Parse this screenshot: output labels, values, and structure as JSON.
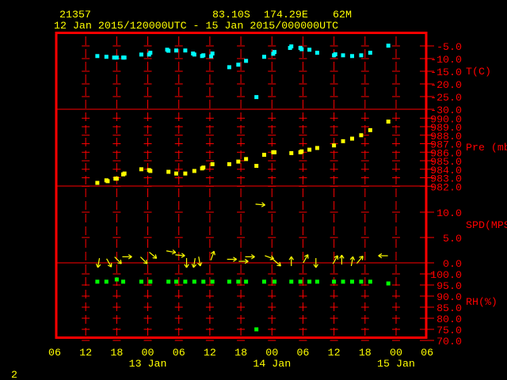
{
  "header": {
    "station_id": "21357",
    "latitude": "83.10S",
    "longitude": "174.29E",
    "elevation": "62M",
    "period": "12 Jan 2015/120000UTC - 15 Jan 2015/000000UTC"
  },
  "footer": {
    "page_number": "2"
  },
  "colors": {
    "frame": "#ff0000",
    "text": "#ffff00",
    "temperature": "#00ffff",
    "pressure": "#ffff00",
    "wind": "#ffff00",
    "humidity": "#00ff00"
  },
  "chart_data": {
    "type": "scatter",
    "grid": true,
    "x_axis": {
      "range": [
        "2015-01-12T06:00",
        "2015-01-15T06:00"
      ],
      "ticks": [
        {
          "time": "2015-01-12T06:00",
          "label": "06"
        },
        {
          "time": "2015-01-12T12:00",
          "label": "12"
        },
        {
          "time": "2015-01-12T18:00",
          "label": "18"
        },
        {
          "time": "2015-01-13T00:00",
          "label": "00"
        },
        {
          "time": "2015-01-13T06:00",
          "label": "06"
        },
        {
          "time": "2015-01-13T12:00",
          "label": "12"
        },
        {
          "time": "2015-01-13T18:00",
          "label": "18"
        },
        {
          "time": "2015-01-14T00:00",
          "label": "00"
        },
        {
          "time": "2015-01-14T06:00",
          "label": "06"
        },
        {
          "time": "2015-01-14T12:00",
          "label": "12"
        },
        {
          "time": "2015-01-14T18:00",
          "label": "18"
        },
        {
          "time": "2015-01-15T00:00",
          "label": "00"
        },
        {
          "time": "2015-01-15T06:00",
          "label": "06"
        }
      ],
      "date_labels": [
        {
          "time": "2015-01-13T00:00",
          "label": "13 Jan"
        },
        {
          "time": "2015-01-14T00:00",
          "label": "14 Jan"
        },
        {
          "time": "2015-01-15T00:00",
          "label": "15 Jan"
        }
      ]
    },
    "panels": [
      {
        "key": "temperature",
        "ylabel": "T(C)",
        "ylim": [
          -30,
          0
        ],
        "color": "#00ffff",
        "ticks": [
          -5,
          -10,
          -15,
          -20,
          -25,
          -30
        ],
        "tick_labels": [
          "-5.0",
          "-10.0",
          "-15.0",
          "-20.0",
          "-25.0",
          "-30.0"
        ],
        "points": [
          [
            "2015-01-12T14:15",
            -9.0
          ],
          [
            "2015-01-12T16:00",
            -9.3
          ],
          [
            "2015-01-12T17:30",
            -9.6
          ],
          [
            "2015-01-12T18:00",
            -9.6
          ],
          [
            "2015-01-12T19:15",
            -9.6
          ],
          [
            "2015-01-12T19:30",
            -9.6
          ],
          [
            "2015-01-12T22:45",
            -8.4
          ],
          [
            "2015-01-13T00:15",
            -8.4
          ],
          [
            "2015-01-13T00:30",
            -7.7
          ],
          [
            "2015-01-13T03:45",
            -6.5
          ],
          [
            "2015-01-13T04:00",
            -6.9
          ],
          [
            "2015-01-13T05:30",
            -6.8
          ],
          [
            "2015-01-13T07:15",
            -6.8
          ],
          [
            "2015-01-13T08:45",
            -8.0
          ],
          [
            "2015-01-13T09:00",
            -8.4
          ],
          [
            "2015-01-13T10:30",
            -9.0
          ],
          [
            "2015-01-13T10:45",
            -8.7
          ],
          [
            "2015-01-13T12:15",
            -9.1
          ],
          [
            "2015-01-13T12:30",
            -8.0
          ],
          [
            "2015-01-13T15:45",
            -13.4
          ],
          [
            "2015-01-13T17:30",
            -12.4
          ],
          [
            "2015-01-13T19:00",
            -10.9
          ],
          [
            "2015-01-13T21:00",
            -25.2
          ],
          [
            "2015-01-13T22:30",
            -9.3
          ],
          [
            "2015-01-14T00:15",
            -8.1
          ],
          [
            "2015-01-14T00:30",
            -7.4
          ],
          [
            "2015-01-14T03:30",
            -5.8
          ],
          [
            "2015-01-14T03:45",
            -5.2
          ],
          [
            "2015-01-14T05:30",
            -5.8
          ],
          [
            "2015-01-14T05:45",
            -6.3
          ],
          [
            "2015-01-14T07:15",
            -6.5
          ],
          [
            "2015-01-14T08:45",
            -7.7
          ],
          [
            "2015-01-14T12:00",
            -8.7
          ],
          [
            "2015-01-14T12:15",
            -8.3
          ],
          [
            "2015-01-14T13:45",
            -8.7
          ],
          [
            "2015-01-14T15:30",
            -9.0
          ],
          [
            "2015-01-14T17:15",
            -8.7
          ],
          [
            "2015-01-14T19:00",
            -7.7
          ],
          [
            "2015-01-14T22:30",
            -4.9
          ]
        ]
      },
      {
        "key": "pressure",
        "ylabel": "Pre (mb)",
        "ylim": [
          982,
          991
        ],
        "color": "#ffff00",
        "ticks": [
          990,
          989,
          988,
          987,
          986,
          985,
          984,
          983,
          982
        ],
        "tick_labels": [
          "990.0",
          "989.0",
          "988.0",
          "987.0",
          "986.0",
          "985.0",
          "984.0",
          "983.0",
          "982.0"
        ],
        "points": [
          [
            "2015-01-12T14:15",
            982.4
          ],
          [
            "2015-01-12T16:00",
            982.7
          ],
          [
            "2015-01-12T16:15",
            982.6
          ],
          [
            "2015-01-12T17:45",
            982.9
          ],
          [
            "2015-01-12T18:00",
            982.9
          ],
          [
            "2015-01-12T19:15",
            983.4
          ],
          [
            "2015-01-12T19:30",
            983.5
          ],
          [
            "2015-01-12T22:45",
            984.0
          ],
          [
            "2015-01-13T00:15",
            983.9
          ],
          [
            "2015-01-13T00:30",
            983.8
          ],
          [
            "2015-01-13T04:00",
            983.7
          ],
          [
            "2015-01-13T05:30",
            983.5
          ],
          [
            "2015-01-13T07:15",
            983.5
          ],
          [
            "2015-01-13T09:00",
            983.8
          ],
          [
            "2015-01-13T10:30",
            984.1
          ],
          [
            "2015-01-13T10:45",
            984.2
          ],
          [
            "2015-01-13T12:30",
            984.6
          ],
          [
            "2015-01-13T15:45",
            984.6
          ],
          [
            "2015-01-13T17:30",
            984.9
          ],
          [
            "2015-01-13T19:00",
            985.2
          ],
          [
            "2015-01-13T21:00",
            984.4
          ],
          [
            "2015-01-13T22:30",
            985.7
          ],
          [
            "2015-01-14T00:15",
            986.0
          ],
          [
            "2015-01-14T00:30",
            986.0
          ],
          [
            "2015-01-14T03:45",
            985.9
          ],
          [
            "2015-01-14T05:30",
            986.0
          ],
          [
            "2015-01-14T05:45",
            986.1
          ],
          [
            "2015-01-14T07:15",
            986.3
          ],
          [
            "2015-01-14T08:45",
            986.5
          ],
          [
            "2015-01-14T12:00",
            986.8
          ],
          [
            "2015-01-14T13:45",
            987.3
          ],
          [
            "2015-01-14T15:30",
            987.6
          ],
          [
            "2015-01-14T17:15",
            988.0
          ],
          [
            "2015-01-14T19:00",
            988.6
          ],
          [
            "2015-01-14T22:30",
            989.6
          ]
        ]
      },
      {
        "key": "wind",
        "ylabel": "SPD(MPS)",
        "ylim": [
          0,
          15
        ],
        "color": "#ffff00",
        "ticks": [
          10,
          5,
          0
        ],
        "tick_labels": [
          "10.0",
          "5.0",
          "0.0"
        ],
        "points_fields": [
          "time",
          "speed_mps",
          "arrow_heading_deg"
        ],
        "points": [
          [
            "2015-01-12T14:30",
            0.0,
            190
          ],
          [
            "2015-01-12T16:30",
            0.0,
            150
          ],
          [
            "2015-01-12T18:15",
            0.5,
            135
          ],
          [
            "2015-01-12T20:00",
            1.2,
            90
          ],
          [
            "2015-01-12T23:15",
            0.5,
            135
          ],
          [
            "2015-01-13T01:00",
            1.5,
            130
          ],
          [
            "2015-01-13T04:30",
            2.2,
            100
          ],
          [
            "2015-01-13T06:15",
            1.5,
            95
          ],
          [
            "2015-01-13T07:30",
            0.0,
            180
          ],
          [
            "2015-01-13T09:00",
            0.0,
            190
          ],
          [
            "2015-01-13T10:00",
            0.3,
            170
          ],
          [
            "2015-01-13T12:30",
            1.4,
            20
          ],
          [
            "2015-01-13T16:15",
            0.7,
            90
          ],
          [
            "2015-01-13T18:30",
            0.3,
            90
          ],
          [
            "2015-01-13T19:45",
            1.2,
            90
          ],
          [
            "2015-01-13T21:45",
            11.5,
            95
          ],
          [
            "2015-01-13T23:30",
            1.1,
            110
          ],
          [
            "2015-01-14T01:00",
            0.0,
            130
          ],
          [
            "2015-01-14T03:45",
            0.3,
            0
          ],
          [
            "2015-01-14T06:30",
            0.8,
            30
          ],
          [
            "2015-01-14T08:30",
            0.0,
            180
          ],
          [
            "2015-01-14T12:15",
            0.6,
            30
          ],
          [
            "2015-01-14T13:30",
            0.6,
            0
          ],
          [
            "2015-01-14T15:30",
            0.3,
            10
          ],
          [
            "2015-01-14T17:00",
            0.6,
            40
          ],
          [
            "2015-01-14T21:30",
            1.4,
            270
          ]
        ]
      },
      {
        "key": "humidity",
        "ylabel": "RH(%)",
        "ylim": [
          70,
          105
        ],
        "color": "#00ff00",
        "ticks": [
          100,
          95,
          90,
          85,
          80,
          75,
          70
        ],
        "tick_labels": [
          "100.0",
          "95.0",
          "90.0",
          "85.0",
          "80.0",
          "75.0",
          "70.0"
        ],
        "points": [
          [
            "2015-01-12T14:15",
            96.5
          ],
          [
            "2015-01-12T16:00",
            96.5
          ],
          [
            "2015-01-12T18:00",
            97.5
          ],
          [
            "2015-01-12T19:15",
            96.5
          ],
          [
            "2015-01-12T22:45",
            96.5
          ],
          [
            "2015-01-13T00:30",
            96.5
          ],
          [
            "2015-01-13T04:00",
            96.5
          ],
          [
            "2015-01-13T05:30",
            96.5
          ],
          [
            "2015-01-13T07:15",
            96.5
          ],
          [
            "2015-01-13T09:00",
            96.5
          ],
          [
            "2015-01-13T10:45",
            96.5
          ],
          [
            "2015-01-13T12:30",
            96.5
          ],
          [
            "2015-01-13T15:45",
            96.5
          ],
          [
            "2015-01-13T17:30",
            96.5
          ],
          [
            "2015-01-13T19:00",
            96.5
          ],
          [
            "2015-01-13T21:00",
            75.0
          ],
          [
            "2015-01-13T22:30",
            96.5
          ],
          [
            "2015-01-14T00:30",
            96.5
          ],
          [
            "2015-01-14T03:45",
            96.5
          ],
          [
            "2015-01-14T05:30",
            96.5
          ],
          [
            "2015-01-14T07:15",
            96.5
          ],
          [
            "2015-01-14T08:45",
            96.5
          ],
          [
            "2015-01-14T12:00",
            96.5
          ],
          [
            "2015-01-14T13:45",
            96.5
          ],
          [
            "2015-01-14T15:30",
            96.5
          ],
          [
            "2015-01-14T17:15",
            96.5
          ],
          [
            "2015-01-14T19:00",
            96.5
          ],
          [
            "2015-01-14T22:30",
            95.7
          ]
        ]
      }
    ]
  }
}
